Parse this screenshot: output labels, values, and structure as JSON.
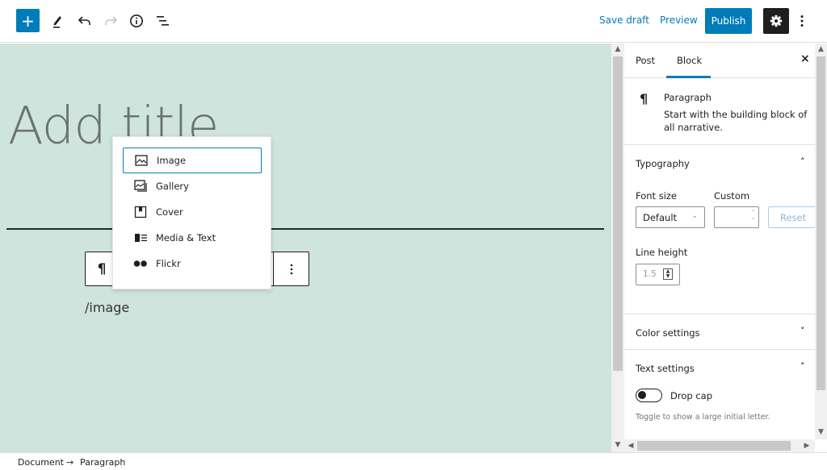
{
  "toolbar": {
    "add_block_icon": "plus-icon",
    "tools_icon": "pencil-icon",
    "undo_icon": "undo-icon",
    "redo_icon": "redo-icon",
    "details_icon": "info-icon",
    "outline_icon": "list-view-icon",
    "save_draft": "Save draft",
    "preview": "Preview",
    "publish": "Publish",
    "settings_icon": "gear-icon",
    "more_icon": "more-vertical-icon",
    "accent": "#007cba"
  },
  "editor": {
    "title_placeholder": "Add title",
    "paragraph_text": "/image",
    "block_toolbar": {
      "type_icon": "¶",
      "more_icon": "⋮"
    },
    "background": "#d0e4de"
  },
  "inserter_popover": {
    "items": [
      {
        "label": "Image",
        "icon": "image-icon",
        "active": true
      },
      {
        "label": "Gallery",
        "icon": "gallery-icon",
        "active": false
      },
      {
        "label": "Cover",
        "icon": "cover-icon",
        "active": false
      },
      {
        "label": "Media & Text",
        "icon": "media-text-icon",
        "active": false
      },
      {
        "label": "Flickr",
        "icon": "flickr-icon",
        "active": false
      }
    ]
  },
  "sidebar": {
    "tabs": [
      {
        "label": "Post",
        "active": false
      },
      {
        "label": "Block",
        "active": true
      }
    ],
    "close_icon": "×",
    "block_card": {
      "icon": "¶",
      "title": "Paragraph",
      "description": "Start with the building block of all narrative."
    },
    "typography": {
      "title": "Typography",
      "font_size_label": "Font size",
      "font_size_value": "Default",
      "custom_label": "Custom",
      "custom_value": "",
      "reset_label": "Reset",
      "line_height_label": "Line height",
      "line_height_value": "1.5",
      "expanded": true
    },
    "color_settings": {
      "title": "Color settings",
      "expanded": false
    },
    "text_settings": {
      "title": "Text settings",
      "expanded": true,
      "drop_cap_label": "Drop cap",
      "drop_cap_enabled": false,
      "help": "Toggle to show a large initial letter."
    }
  },
  "footer": {
    "breadcrumbs": [
      "Document",
      "Paragraph"
    ],
    "separator": "→"
  }
}
